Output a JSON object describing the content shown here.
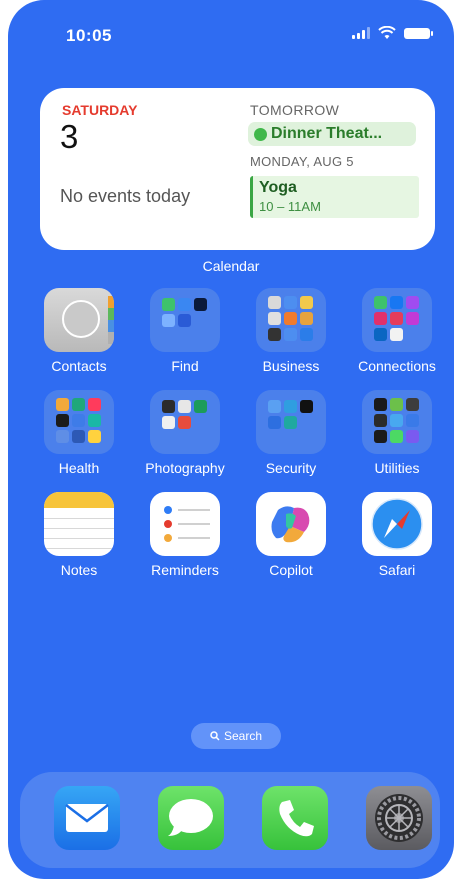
{
  "status_bar": {
    "time": "10:05"
  },
  "widget": {
    "day_name": "SATURDAY",
    "date": "3",
    "no_events": "No events today",
    "tomorrow_label": "TOMORROW",
    "tomorrow_event": "Dinner Theat...",
    "monday_label": "MONDAY, AUG 5",
    "monday_event_title": "Yoga",
    "monday_event_time": "10 – 11AM",
    "caption": "Calendar"
  },
  "apps": [
    {
      "label": "Contacts",
      "icon": "contacts-icon"
    },
    {
      "label": "Find",
      "icon": "folder-icon"
    },
    {
      "label": "Business",
      "icon": "folder-icon"
    },
    {
      "label": "Connections",
      "icon": "folder-icon"
    },
    {
      "label": "Health",
      "icon": "folder-icon"
    },
    {
      "label": "Photography",
      "icon": "folder-icon"
    },
    {
      "label": "Security",
      "icon": "folder-icon"
    },
    {
      "label": "Utilities",
      "icon": "folder-icon"
    },
    {
      "label": "Notes",
      "icon": "notes-icon"
    },
    {
      "label": "Reminders",
      "icon": "reminders-icon"
    },
    {
      "label": "Copilot",
      "icon": "copilot-icon"
    },
    {
      "label": "Safari",
      "icon": "safari-icon"
    }
  ],
  "search": {
    "label": "Search"
  },
  "dock": [
    {
      "name": "mail-icon"
    },
    {
      "name": "messages-icon"
    },
    {
      "name": "phone-icon"
    },
    {
      "name": "settings-icon"
    }
  ],
  "colors": {
    "wallpaper": "#2f6cf2",
    "calendar_red": "#e53b2e",
    "event_green": "#3aa644"
  }
}
